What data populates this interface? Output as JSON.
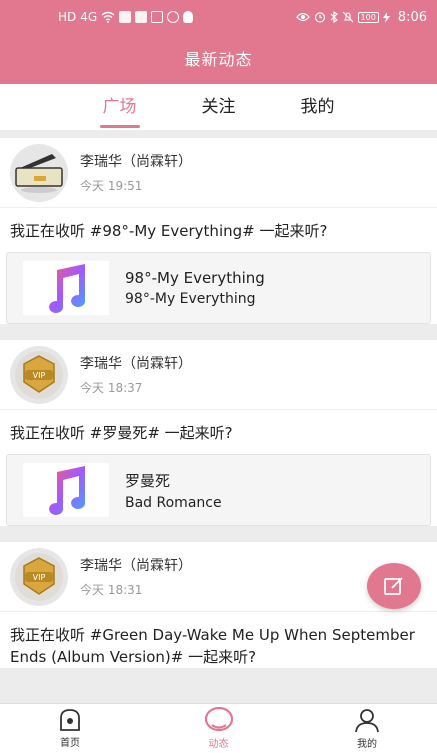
{
  "status_bar": {
    "left_labels": [
      "HD",
      "4G"
    ],
    "battery": "100",
    "time": "8:06"
  },
  "header": {
    "title": "最新动态"
  },
  "tabs": [
    {
      "label": "广场",
      "active": true
    },
    {
      "label": "关注",
      "active": false
    },
    {
      "label": "我的",
      "active": false
    }
  ],
  "posts": [
    {
      "user": "李瑞华（尚霖轩）",
      "time": "今天 19:51",
      "text": "我正在收听 #98°-My Everything# 一起来听?",
      "music_title": "98°-My Everything",
      "music_artist": "98°-My Everything",
      "avatar_icon": "radio-avatar-icon"
    },
    {
      "user": "李瑞华（尚霖轩）",
      "time": "今天 18:37",
      "text": "我正在收听 #罗曼死# 一起来听?",
      "music_title": "罗曼死",
      "music_artist": "Bad Romance",
      "avatar_icon": "vip-badge-icon"
    },
    {
      "user": "李瑞华（尚霖轩）",
      "time": "今天 18:31",
      "text": "我正在收听 #Green Day-Wake Me Up When September Ends (Album Version)# 一起来听?",
      "avatar_icon": "vip-badge-icon"
    }
  ],
  "vip_label": "VIP",
  "bottom_nav": [
    {
      "label": "首页",
      "icon": "home-icon"
    },
    {
      "label": "动态",
      "icon": "chat-bubble-icon",
      "active": true
    },
    {
      "label": "我的",
      "icon": "person-icon"
    }
  ],
  "colors": {
    "accent": "#e2788f"
  }
}
